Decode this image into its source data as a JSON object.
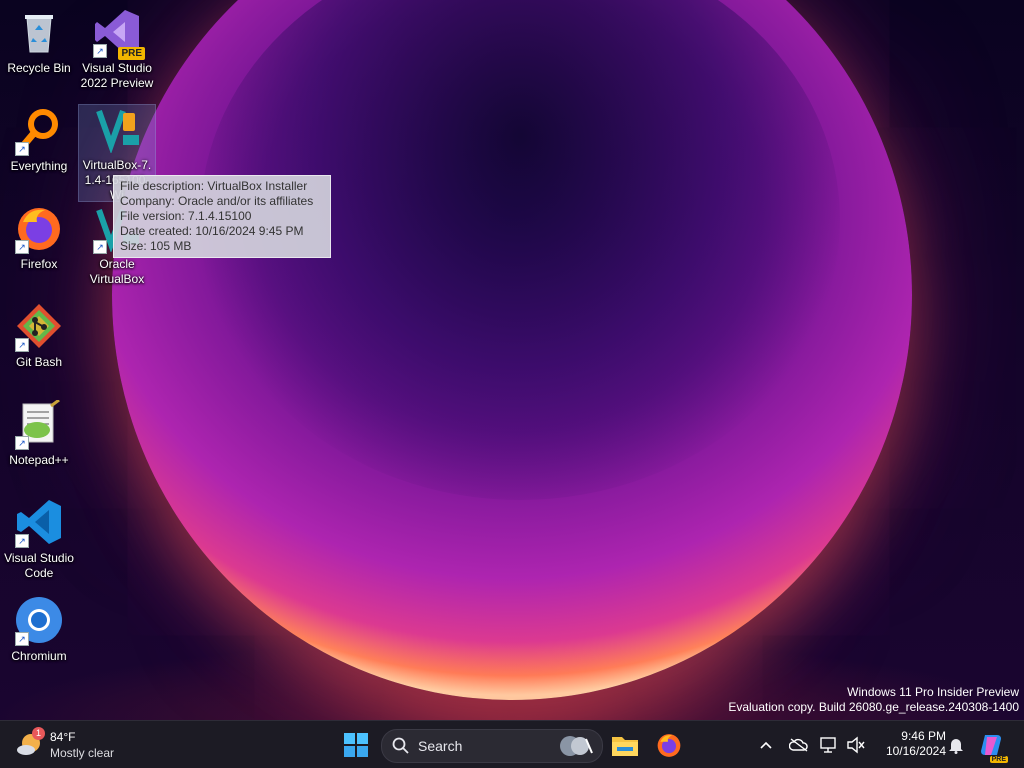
{
  "desktop": {
    "icons": [
      {
        "label": "Recycle Bin"
      },
      {
        "label": "Visual Studio 2022 Preview",
        "badge": "PRE"
      },
      {
        "label": "Everything"
      },
      {
        "label": "VirtualBox-7.1.4-165100-Wi"
      },
      {
        "label": "Firefox"
      },
      {
        "label": "Oracle VirtualBox"
      },
      {
        "label": "Git Bash"
      },
      {
        "label": "Notepad++"
      },
      {
        "label": "Visual Studio Code"
      },
      {
        "label": "Chromium"
      }
    ],
    "tooltip": {
      "lines": [
        "File description: VirtualBox Installer",
        "Company: Oracle and/or its affiliates",
        "File version: 7.1.4.15100",
        "Date created: 10/16/2024 9:45 PM",
        "Size: 105 MB"
      ]
    },
    "watermark": {
      "line1": "Windows 11 Pro Insider Preview",
      "line2": "Evaluation copy. Build 26080.ge_release.240308-1400"
    }
  },
  "taskbar": {
    "weather": {
      "badge": "1",
      "temp": "84°F",
      "condition": "Mostly clear"
    },
    "search": {
      "label": "Search"
    },
    "clock": {
      "time": "9:46 PM",
      "date": "10/16/2024"
    },
    "copilot_badge": "PRE"
  },
  "colors": {
    "taskbar_bg": "#1c1b24",
    "accent_blue": "#0a84ff",
    "tooltip_bg": "#d2d2dc"
  }
}
